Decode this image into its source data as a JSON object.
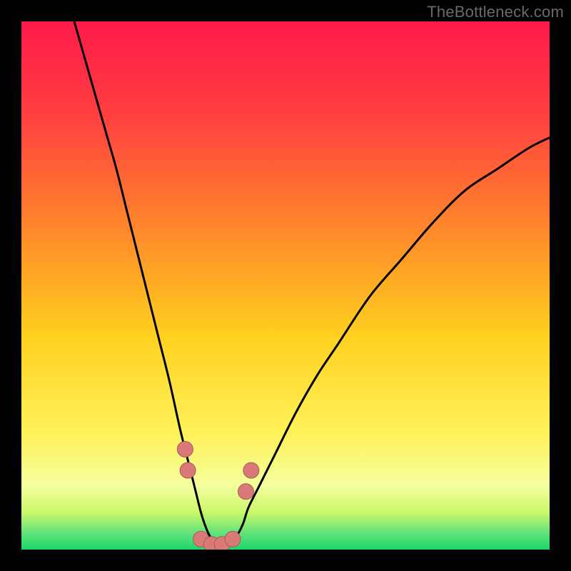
{
  "watermark": "TheBottleneck.com",
  "colors": {
    "frame_bg": "#000000",
    "grad_top": "#ff1a4a",
    "grad_mid1": "#ff7a2a",
    "grad_mid2": "#ffd21f",
    "grad_mid3": "#fff25a",
    "grad_bottom_hi": "#f4ff9e",
    "grad_green1": "#5ee27a",
    "grad_green2": "#1fd66b",
    "curve_stroke": "#000000",
    "marker_fill": "#d97a78",
    "marker_stroke": "#a85a58"
  },
  "chart_data": {
    "type": "line",
    "title": "",
    "xlabel": "",
    "ylabel": "",
    "xlim": [
      0,
      100
    ],
    "ylim": [
      0,
      100
    ],
    "series": [
      {
        "name": "bottleneck-curve",
        "x": [
          10,
          12,
          14,
          16,
          18,
          20,
          22,
          24,
          26,
          28,
          30,
          31,
          32,
          33,
          34,
          35,
          36,
          37,
          38,
          39,
          40,
          41,
          42,
          43,
          45,
          48,
          52,
          56,
          60,
          66,
          72,
          78,
          84,
          90,
          96,
          100
        ],
        "values": [
          100,
          93,
          86,
          79,
          72,
          64,
          56,
          48,
          40,
          32,
          23,
          19,
          15,
          11,
          7,
          4,
          2,
          1,
          1,
          1,
          2,
          3,
          5,
          8,
          12,
          18,
          26,
          33,
          39,
          48,
          55,
          62,
          68,
          72,
          76,
          78
        ]
      }
    ],
    "markers": [
      {
        "x": 31.0,
        "y": 19
      },
      {
        "x": 31.5,
        "y": 15
      },
      {
        "x": 34.0,
        "y": 2
      },
      {
        "x": 36.0,
        "y": 1
      },
      {
        "x": 38.0,
        "y": 1
      },
      {
        "x": 40.0,
        "y": 2
      },
      {
        "x": 42.5,
        "y": 11
      },
      {
        "x": 43.5,
        "y": 15
      }
    ],
    "gradient_stops": [
      {
        "offset": 0.0,
        "color": "#ff1a4a"
      },
      {
        "offset": 0.18,
        "color": "#ff4040"
      },
      {
        "offset": 0.4,
        "color": "#ff8a2a"
      },
      {
        "offset": 0.6,
        "color": "#ffd21f"
      },
      {
        "offset": 0.78,
        "color": "#fff25a"
      },
      {
        "offset": 0.88,
        "color": "#f4ff9e"
      },
      {
        "offset": 0.93,
        "color": "#c9f76a"
      },
      {
        "offset": 0.97,
        "color": "#5ee27a"
      },
      {
        "offset": 1.0,
        "color": "#1fd66b"
      }
    ]
  }
}
